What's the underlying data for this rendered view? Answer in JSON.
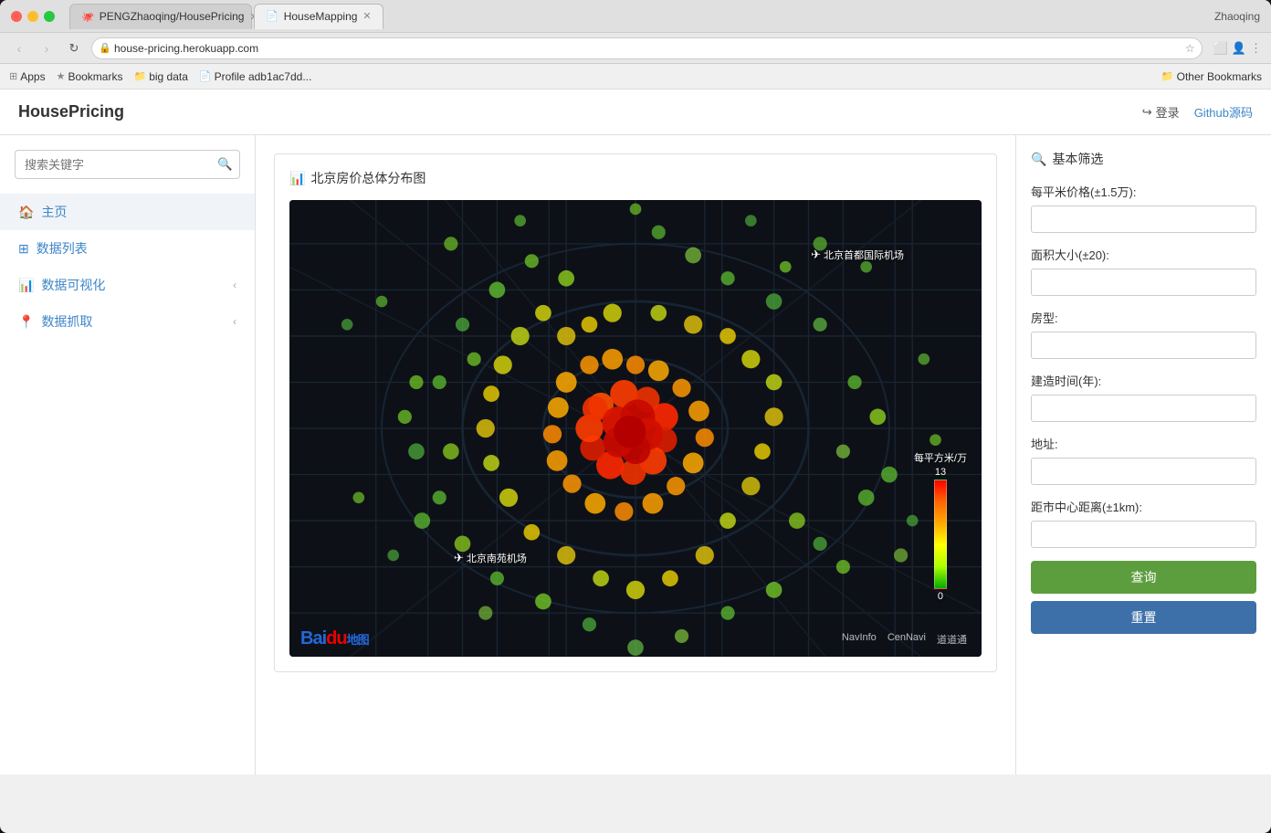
{
  "browser": {
    "tabs": [
      {
        "id": "tab1",
        "icon": "🐙",
        "label": "PENGZhaoqing/HousePricing",
        "active": false
      },
      {
        "id": "tab2",
        "icon": "📄",
        "label": "HouseMapping",
        "active": true
      }
    ],
    "url": "house-pricing.herokuapp.com",
    "user": "Zhaoqing"
  },
  "bookmarks": {
    "items": [
      {
        "icon": "⊞",
        "label": "Apps"
      },
      {
        "icon": "★",
        "label": "Bookmarks"
      },
      {
        "icon": "📁",
        "label": "big data"
      },
      {
        "icon": "📄",
        "label": "Profile adb1ac7dd..."
      }
    ],
    "other": "Other Bookmarks"
  },
  "header": {
    "logo": "HousePricing",
    "login_label": "登录",
    "github_label": "Github源码"
  },
  "sidebar": {
    "search_placeholder": "搜索关键字",
    "nav_items": [
      {
        "id": "home",
        "icon": "🏠",
        "label": "主页",
        "active": true,
        "arrow": false
      },
      {
        "id": "data-list",
        "icon": "⊞",
        "label": "数据列表",
        "active": false,
        "arrow": false
      },
      {
        "id": "data-viz",
        "icon": "📊",
        "label": "数据可视化",
        "active": false,
        "arrow": true
      },
      {
        "id": "data-crawl",
        "icon": "📍",
        "label": "数据抓取",
        "active": false,
        "arrow": true
      }
    ]
  },
  "main": {
    "panel_title_icon": "📊",
    "panel_title": "北京房价总体分布图",
    "map": {
      "label1": "北京首都国际机场",
      "label2": "北京南苑机场",
      "legend_top": "每平方米/万",
      "legend_max": "13",
      "legend_min": "0",
      "attribution": [
        "NavInfo",
        "CenNavi",
        "道道通"
      ]
    }
  },
  "filter": {
    "title": "基本筛选",
    "fields": [
      {
        "id": "price",
        "label": "每平米价格(±1.5万):",
        "placeholder": ""
      },
      {
        "id": "area",
        "label": "面积大小(±20):",
        "placeholder": ""
      },
      {
        "id": "room-type",
        "label": "房型:",
        "placeholder": ""
      },
      {
        "id": "year",
        "label": "建造时间(年):",
        "placeholder": ""
      },
      {
        "id": "address",
        "label": "地址:",
        "placeholder": ""
      },
      {
        "id": "distance",
        "label": "距市中心距离(±1km):",
        "placeholder": ""
      }
    ],
    "query_btn": "查询",
    "reset_btn": "重置"
  }
}
